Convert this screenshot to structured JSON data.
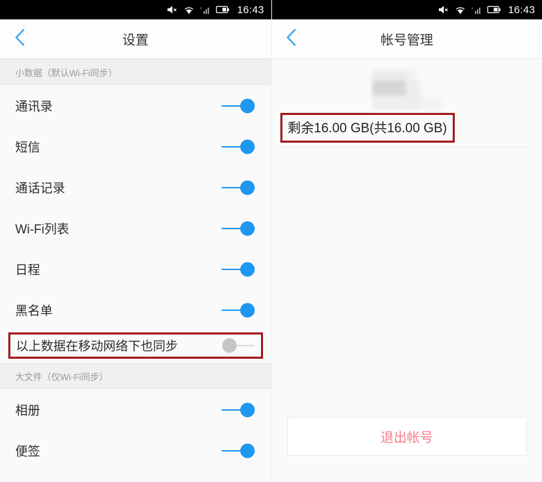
{
  "status_bar": {
    "time": "16:43",
    "icons": [
      "volume-mute-icon",
      "wifi-icon",
      "signal-no-service-icon",
      "battery-icon"
    ]
  },
  "colors": {
    "accent_blue": "#1f97f0",
    "annotation_red": "#a41c1c",
    "logout_pink": "#fa7b8c",
    "page_bg": "#fafafa",
    "section_header_bg": "#f0f0f0"
  },
  "left_panel": {
    "nav": {
      "back_icon": "chevron-left-icon",
      "title": "设置"
    },
    "sections": [
      {
        "header": "小数据（默认Wi-Fi同步）",
        "rows": [
          {
            "label": "通讯录",
            "toggle": "on"
          },
          {
            "label": "短信",
            "toggle": "on"
          },
          {
            "label": "通话记录",
            "toggle": "on"
          },
          {
            "label": "Wi-Fi列表",
            "toggle": "on"
          },
          {
            "label": "日程",
            "toggle": "on"
          },
          {
            "label": "黑名单",
            "toggle": "on"
          }
        ]
      }
    ],
    "highlighted_row": {
      "label": "以上数据在移动网络下也同步",
      "toggle": "off"
    },
    "second_section": {
      "header": "大文件（仅Wi-Fi同步）",
      "rows": [
        {
          "label": "相册",
          "toggle": "on"
        },
        {
          "label": "便签",
          "toggle": "on"
        }
      ]
    }
  },
  "right_panel": {
    "nav": {
      "back_icon": "chevron-left-icon",
      "title": "帐号管理"
    },
    "account_name_redacted": "",
    "storage_text": "剩余16.00 GB(共16.00 GB)",
    "logout_label": "退出帐号"
  }
}
